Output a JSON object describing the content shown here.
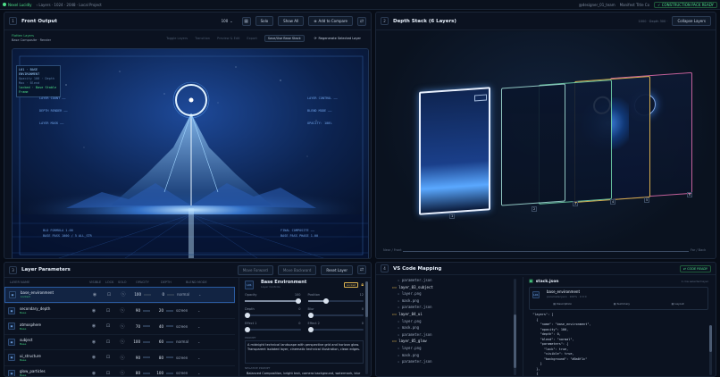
{
  "topbar": {
    "brand": "Nexel Lucidly",
    "crumbs": "‹ Layers · 1024 · 2048 · Local Project",
    "user": "@designer_01_team",
    "mode": "Manifest Title Co",
    "status": "CONSTRUCTION PACK READY"
  },
  "front": {
    "num": "1",
    "title": "Front Output",
    "zoom": "100",
    "solo": "Solo",
    "show_all": "Show All",
    "add": "Add to Compare",
    "sub_left": "Flatten Layers",
    "sub_info": "Base Composite · Render",
    "sub_items": [
      "Toggle Layers",
      "Transition",
      "Preview & Edit",
      "Export"
    ],
    "sub_btn1": "Save/Use Base Stack",
    "sub_btn2": "Regenerate Selected Layer",
    "tag": {
      "a": "L01 · BASE ENVIRONMENT",
      "b": "Opacity 100 · Depth Max · Blend",
      "c": "locked · Base Stable Frame"
    },
    "hud_left": [
      "LAYER COUNT ——",
      "DEPTH RENDER ——",
      "LAYER MASK ——"
    ],
    "hud_right": [
      "LAYER CONTROL ——",
      "BLEND MODE ——",
      "OPACITY: 100%"
    ],
    "hud_bl": [
      "BLD FORMULA 1.00",
      "BASE PASS 1000 / 5 ALL_STR"
    ],
    "hud_br": [
      "FINAL COMPOSITE ——",
      "BASE PASS PHASE 1.00"
    ]
  },
  "depth": {
    "num": "2",
    "title": "Depth Stack (6 Layers)",
    "meta": "1000 · Depth 300 ·",
    "collapse": "Collapse Layers",
    "cards": [
      "1",
      "2",
      "3",
      "4",
      "5",
      "6"
    ],
    "axis_left": "Near / Front",
    "axis_right": "Far / Back"
  },
  "params": {
    "num": "3",
    "title": "Layer Parameters",
    "move_fwd": "Move Forward",
    "move_bwd": "Move Backward",
    "reset": "Reset Layer",
    "cols": [
      "LAYER NAME",
      "VISIBLE",
      "LOCK",
      "SOLO",
      "OPACITY",
      "DEPTH",
      "BLEND MODE"
    ],
    "rows": [
      {
        "name": "base_environment",
        "sub": "Locked",
        "op": "100",
        "dp": "0",
        "bl": "normal"
      },
      {
        "name": "secondary_depth",
        "sub": "Base",
        "op": "90",
        "dp": "20",
        "bl": "screen"
      },
      {
        "name": "atmosphere",
        "sub": "Base",
        "op": "70",
        "dp": "40",
        "bl": "screen"
      },
      {
        "name": "subject",
        "sub": "Base",
        "op": "100",
        "dp": "60",
        "bl": "normal"
      },
      {
        "name": "ui_structure",
        "sub": "Base",
        "op": "90",
        "dp": "80",
        "bl": "screen"
      },
      {
        "name": "glow_particles",
        "sub": "Base",
        "op": "80",
        "dp": "100",
        "bl": "screen"
      }
    ],
    "detail": {
      "icon": "L01",
      "name": "Base Environment",
      "sub": "Layer Controls",
      "badge": "Locked",
      "opacity_l": "Opacity",
      "opacity_v": "100",
      "position_l": "Position",
      "position_v": "12",
      "depth_l": "Depth",
      "depth_v": "0",
      "blur_l": "Blur",
      "blur_v": "0",
      "effect_l": "Effect 1",
      "effect_v": "0",
      "effect2_l": "Effect 2",
      "effect2_v": "0",
      "prompt_l": "PROMPT",
      "prompt": "A midnight technical landscape with perspective grid and horizon glow. Transparent isolated layer, cinematic technical illustration, clean edges.",
      "neg_l": "NEGATIVE PROMPT",
      "neg": "Balanced Composition, bright text, camera background, watermark, blur"
    }
  },
  "code": {
    "num": "4",
    "title": "VS Code Mapping",
    "badge": "CODE READY",
    "tree": [
      "parameter.json",
      "layer_03_subject",
      "layer.png",
      "mask.png",
      "parameter.json",
      "layer_04_ui",
      "layer.png",
      "mask.png",
      "parameter.json",
      "layer_05_glow",
      "layer.png",
      "mask.png",
      "parameter.json"
    ],
    "file": "stack.json",
    "file_meta": "1 row selected layer",
    "sel_icon": "L01",
    "sel_name": "base_environment",
    "sel_sub": "parameter.json · 100% · 0 0 0",
    "actions": [
      "Description",
      "Summary",
      "Layout"
    ],
    "json": "  \"layers\": [\n    {\n      \"name\": \"base_environment\",\n      \"opacity\": 100,\n      \"depth\": 0,\n      \"blend\": \"normal\",\n      \"parameters\": {\n        \"lock\": true,\n        \"visible\": true,\n        \"background\": \"#0a0f1c\"\n      }\n    },\n    {\n      \"id\": \"L02\",\n      \"name\": \"secondary_depth\",\n      \"opacity\": 90,\n      \"depth\": 20,"
  }
}
